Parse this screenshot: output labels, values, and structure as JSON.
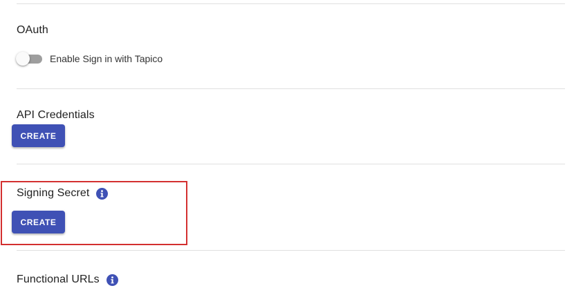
{
  "oauth": {
    "title": "OAuth",
    "toggle_label": "Enable Sign in with Tapico",
    "toggle_on": false
  },
  "api_credentials": {
    "title": "API Credentials",
    "button_label": "CREATE"
  },
  "signing_secret": {
    "title": "Signing Secret",
    "button_label": "CREATE",
    "info_icon": "info-icon"
  },
  "functional_urls": {
    "title": "Functional URLs",
    "info_icon": "info-icon"
  },
  "colors": {
    "accent": "#3f51b5",
    "highlight": "#d32f2f",
    "divider": "#e0e0e0"
  }
}
